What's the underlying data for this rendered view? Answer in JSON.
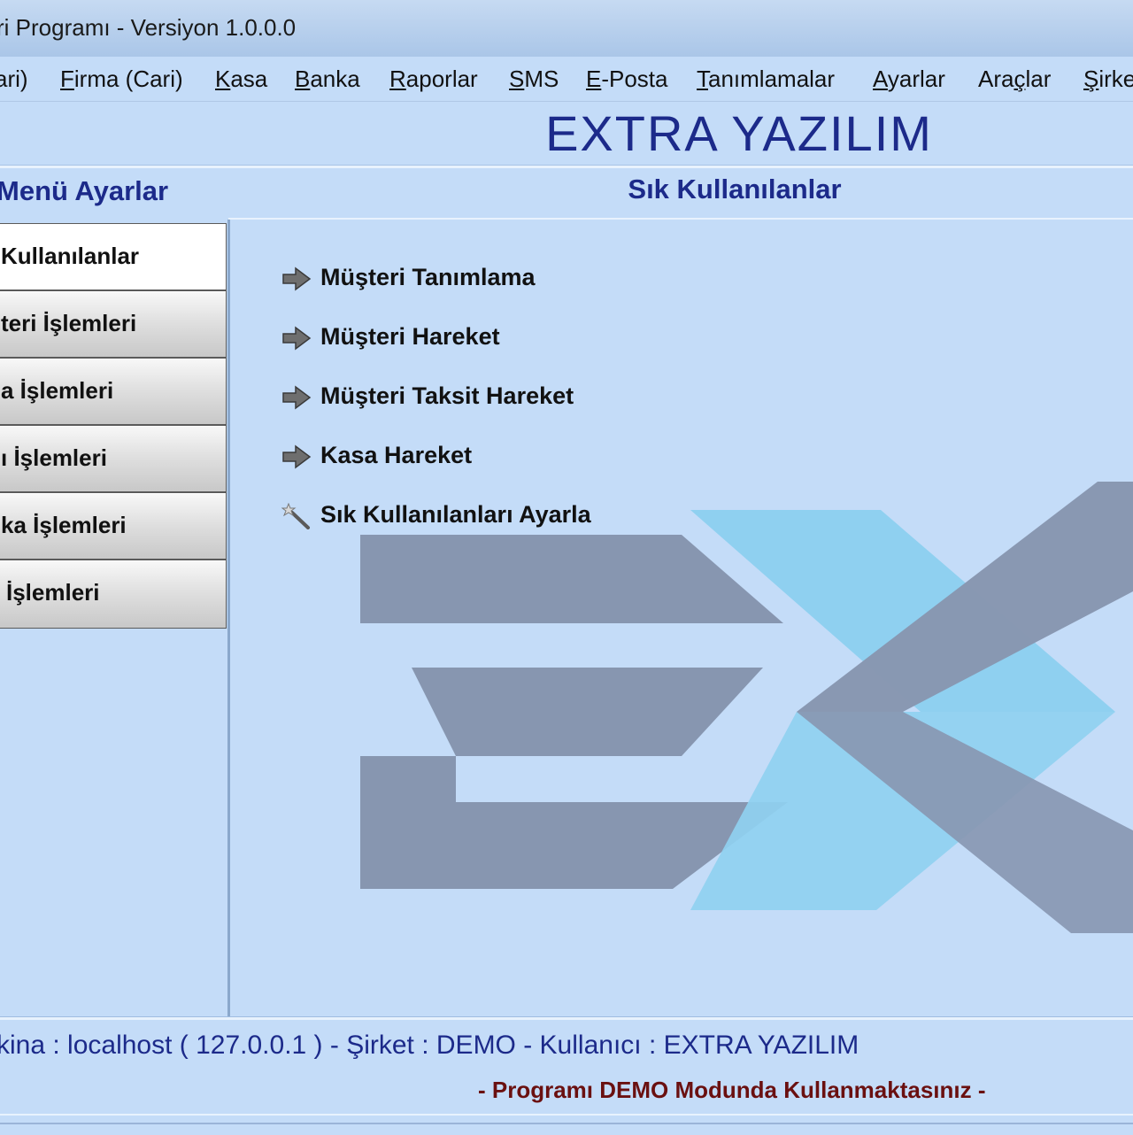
{
  "window": {
    "title": "ri Programı - Versiyon 1.0.0.0"
  },
  "menu": [
    {
      "label": "ari)",
      "accel": ""
    },
    {
      "label": "Firma (Cari)",
      "accel": "F"
    },
    {
      "label": "Kasa",
      "accel": "K"
    },
    {
      "label": "Banka",
      "accel": "B"
    },
    {
      "label": "Raporlar",
      "accel": "R"
    },
    {
      "label": "SMS",
      "accel": "S"
    },
    {
      "label": "E-Posta",
      "accel": "E"
    },
    {
      "label": "Tanımlamalar",
      "accel": "T"
    },
    {
      "label": "Ayarlar",
      "accel": "A"
    },
    {
      "label": "Araçlar",
      "accel": "ç"
    },
    {
      "label": "Şirke",
      "accel": "Ş"
    }
  ],
  "brand": "EXTRA YAZILIM",
  "left_panel": {
    "header": "Menü Ayarlar",
    "items": [
      {
        "label": "Kullanılanlar",
        "active": true
      },
      {
        "label": "teri İşlemleri",
        "active": false
      },
      {
        "label": "a İşlemleri",
        "active": false
      },
      {
        "label": "ı İşlemleri",
        "active": false
      },
      {
        "label": "ka İşlemleri",
        "active": false
      },
      {
        "label": "İşlemleri",
        "active": false
      }
    ]
  },
  "main_panel": {
    "header": "Sık Kullanılanlar",
    "items": [
      {
        "label": "Müşteri Tanımlama",
        "icon": "arrow-right-icon"
      },
      {
        "label": "Müşteri Hareket",
        "icon": "arrow-right-icon"
      },
      {
        "label": "Müşteri Taksit Hareket",
        "icon": "arrow-right-icon"
      },
      {
        "label": "Kasa Hareket",
        "icon": "arrow-right-icon"
      },
      {
        "label": "Sık Kullanılanları Ayarla",
        "icon": "magic-wand-icon"
      }
    ]
  },
  "status": {
    "line1": "kina : localhost ( 127.0.0.1 ) - Şirket : DEMO  -  Kullanıcı : EXTRA YAZILIM",
    "line2": "- Programı DEMO Modunda Kullanmaktasınız -"
  },
  "colors": {
    "background": "#c4dcf8",
    "heading": "#1c2a8a",
    "demo_text": "#6a1010",
    "logo_gray": "#8796b0",
    "logo_blue": "#8fd0f0"
  }
}
